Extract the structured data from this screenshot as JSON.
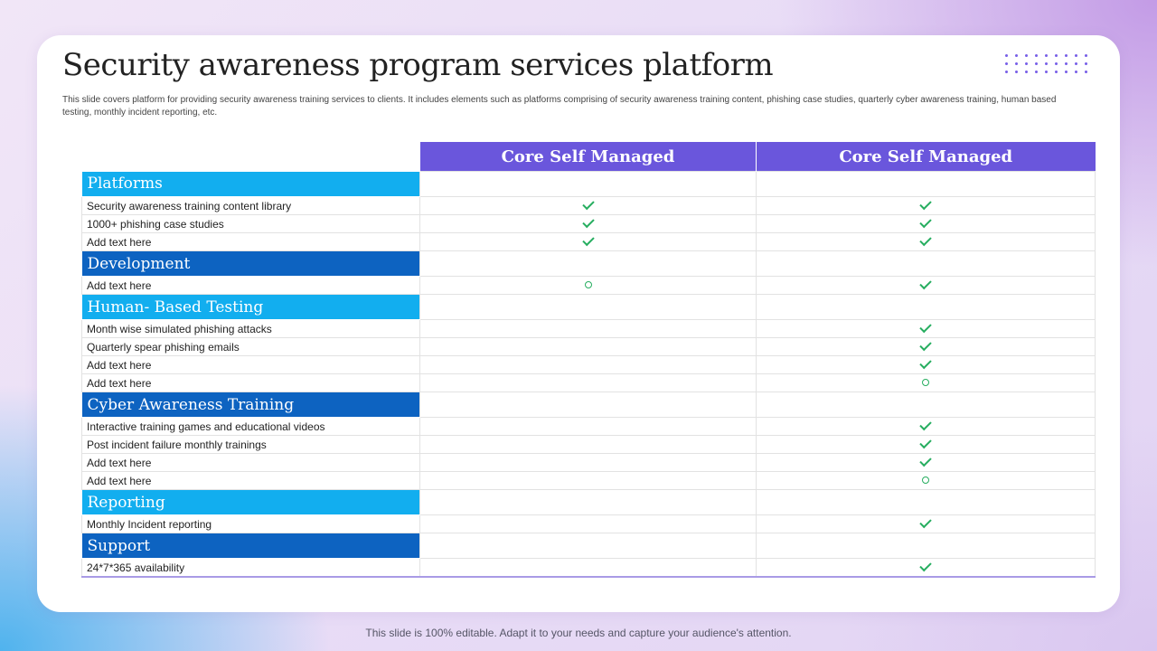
{
  "slide": {
    "title": "Security awareness program services platform",
    "subtitle": "This slide covers platform for providing security awareness training services to clients. It includes elements such as platforms comprising of security awareness training content, phishing case studies, quarterly cyber awareness training, human based testing, monthly incident reporting, etc.",
    "footer": "This slide is 100% editable. Adapt it to your needs and capture your audience's attention."
  },
  "table": {
    "columns": [
      "Core Self Managed",
      "Core Self Managed"
    ],
    "sections": [
      {
        "title": "Platforms",
        "items": [
          {
            "label": "Security awareness training content library",
            "marks": [
              "check-icon",
              "check-icon"
            ]
          },
          {
            "label": "1000+ phishing case studies",
            "marks": [
              "check-icon",
              "check-icon"
            ]
          },
          {
            "label": "Add text here",
            "marks": [
              "check-icon",
              "check-icon"
            ]
          }
        ]
      },
      {
        "title": "Development",
        "items": [
          {
            "label": "Add text here",
            "marks": [
              "circle-icon",
              "check-icon"
            ]
          }
        ]
      },
      {
        "title": "Human- Based Testing",
        "items": [
          {
            "label": "Month wise simulated phishing attacks",
            "marks": [
              "",
              "check-icon"
            ]
          },
          {
            "label": "Quarterly spear phishing emails",
            "marks": [
              "",
              "check-icon"
            ]
          },
          {
            "label": "Add text here",
            "marks": [
              "",
              "check-icon"
            ]
          },
          {
            "label": "Add text here",
            "marks": [
              "",
              "circle-icon"
            ]
          }
        ]
      },
      {
        "title": "Cyber Awareness Training",
        "items": [
          {
            "label": "Interactive training games and educational videos",
            "marks": [
              "",
              "check-icon"
            ]
          },
          {
            "label": "Post incident failure monthly trainings",
            "marks": [
              "",
              "check-icon"
            ]
          },
          {
            "label": "Add text here",
            "marks": [
              "",
              "check-icon"
            ]
          },
          {
            "label": "Add text here",
            "marks": [
              "",
              "circle-icon"
            ]
          }
        ]
      },
      {
        "title": "Reporting",
        "items": [
          {
            "label": "Monthly Incident reporting",
            "marks": [
              "",
              "check-icon"
            ]
          }
        ]
      },
      {
        "title": "Support",
        "items": [
          {
            "label": "24*7*365 availability",
            "marks": [
              "",
              "check-icon"
            ]
          }
        ]
      }
    ]
  },
  "colors": {
    "header": "#6a56dc",
    "section_light": "#12aeef",
    "section_dark": "#0d63c1",
    "check": "#27ae60"
  }
}
